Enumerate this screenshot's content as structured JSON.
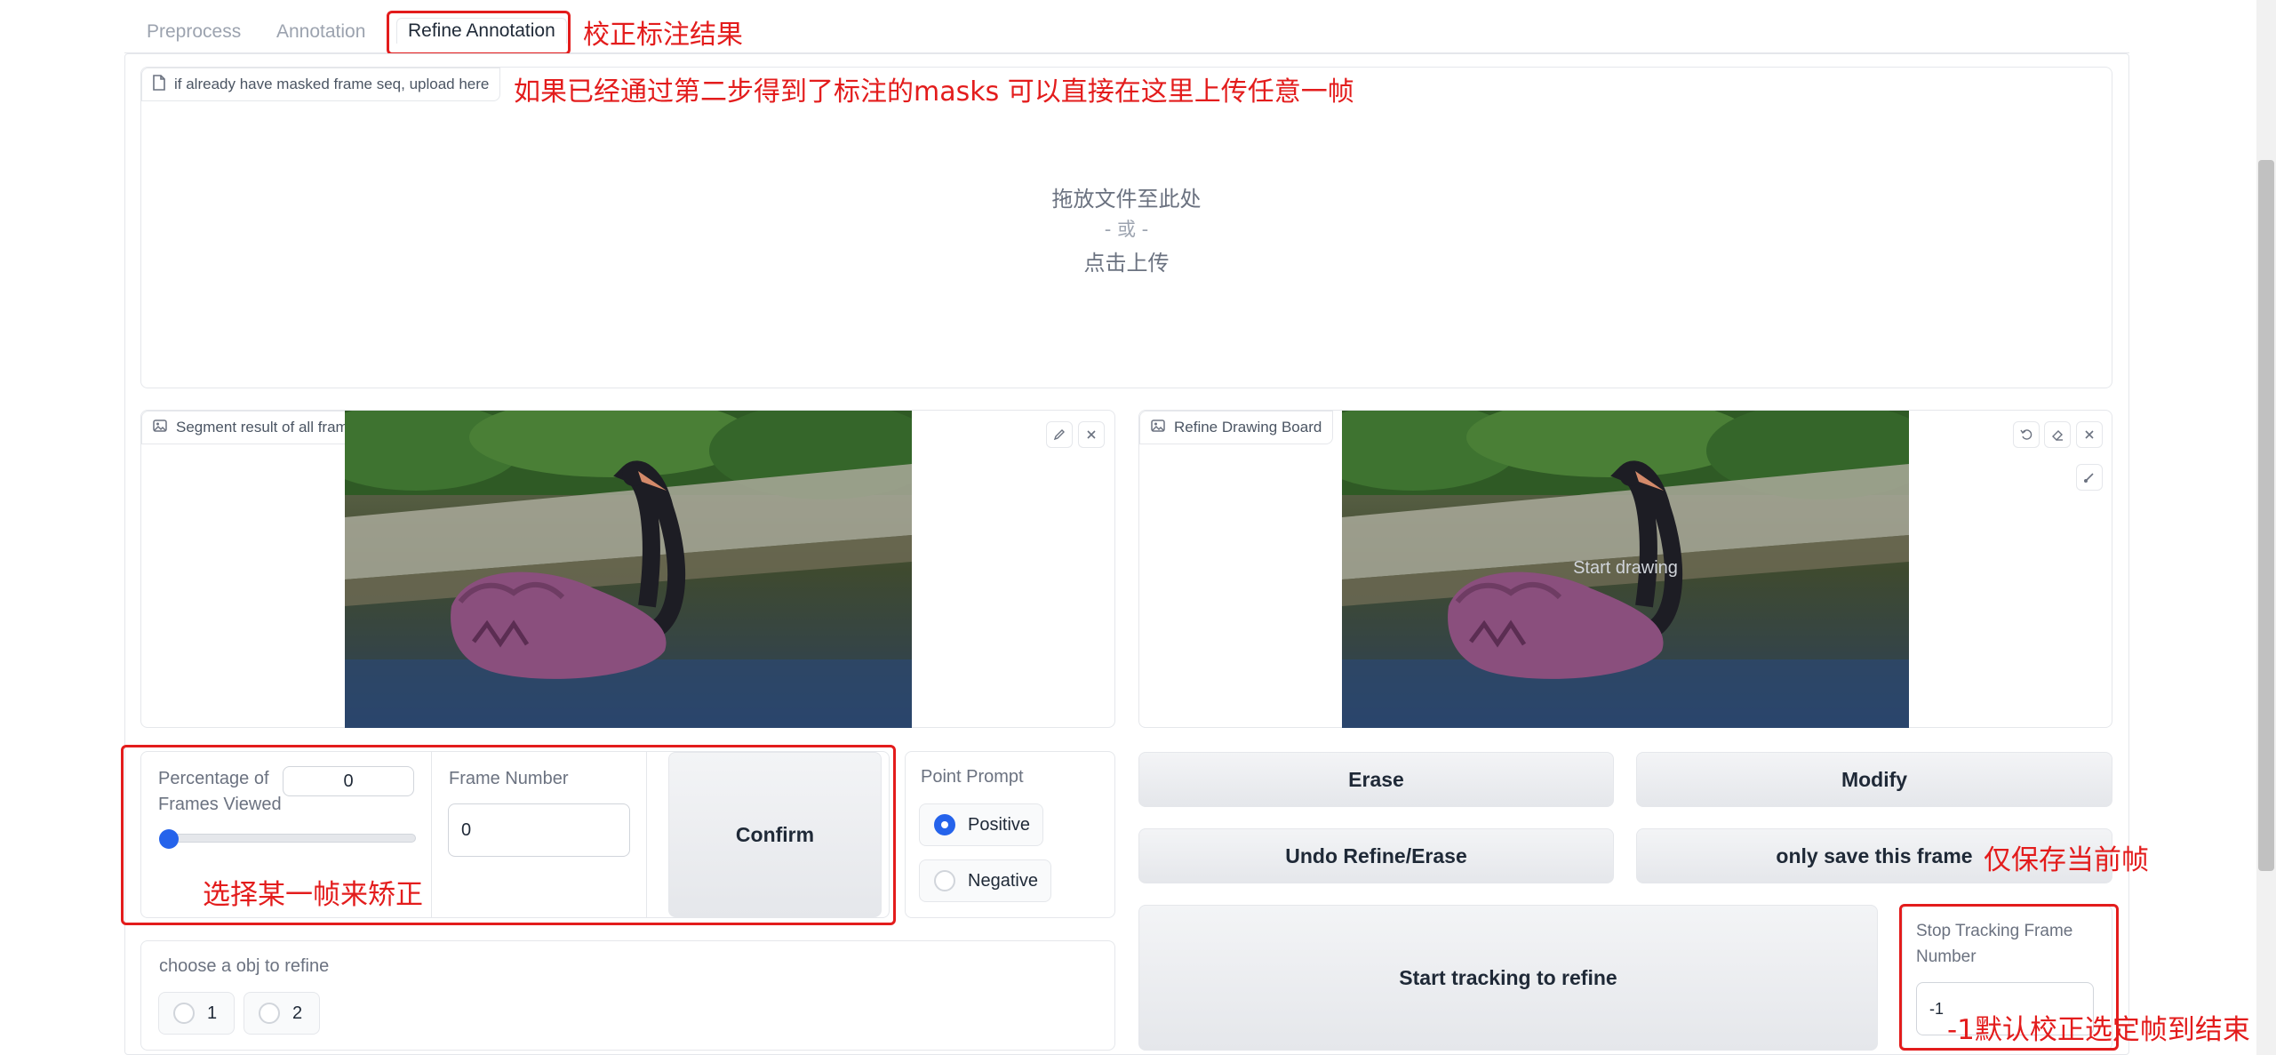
{
  "tabs": [
    {
      "label": "Preprocess"
    },
    {
      "label": "Annotation"
    },
    {
      "label": "Refine Annotation"
    }
  ],
  "upload": {
    "label": "if already have masked frame seq, upload here",
    "drop_text": "拖放文件至此处",
    "or_text": "- 或 -",
    "click_text": "点击上传"
  },
  "segment_image": {
    "label": "Segment result of all frames"
  },
  "drawing_board": {
    "label": "Refine Drawing Board",
    "overlay": "Start drawing"
  },
  "controls": {
    "percentage_label_1": "Percentage of",
    "percentage_label_2": "Frames Viewed",
    "percentage_value": "0",
    "slider_value": 0,
    "frame_number_label": "Frame Number",
    "frame_number_value": "0",
    "confirm_label": "Confirm"
  },
  "point_prompt": {
    "label": "Point Prompt",
    "options": [
      {
        "label": "Positive"
      },
      {
        "label": "Negative"
      }
    ],
    "selected": "Positive"
  },
  "buttons": {
    "erase": "Erase",
    "modify": "Modify",
    "undo": "Undo Refine/Erase",
    "save_frame": "only save this frame",
    "start_tracking": "Start tracking to refine"
  },
  "stop_tracking": {
    "label_1": "Stop Tracking Frame",
    "label_2": "Number",
    "value": "-1"
  },
  "obj_choice": {
    "label": "choose a obj to refine",
    "options": [
      {
        "label": "1"
      },
      {
        "label": "2"
      }
    ]
  },
  "annotations": {
    "refine_tab": "校正标注结果",
    "upload_note": "如果已经通过第二步得到了标注的masks 可以直接在这里上传任意一帧",
    "select_frame": "选择某一帧来矫正",
    "save_note": "仅保存当前帧",
    "stop_note": "-1默认校正选定帧到结束"
  },
  "colors": {
    "annotation_red": "#e31c1c",
    "accent_blue": "#2563eb",
    "mask_purple": "#8a4f7d"
  }
}
